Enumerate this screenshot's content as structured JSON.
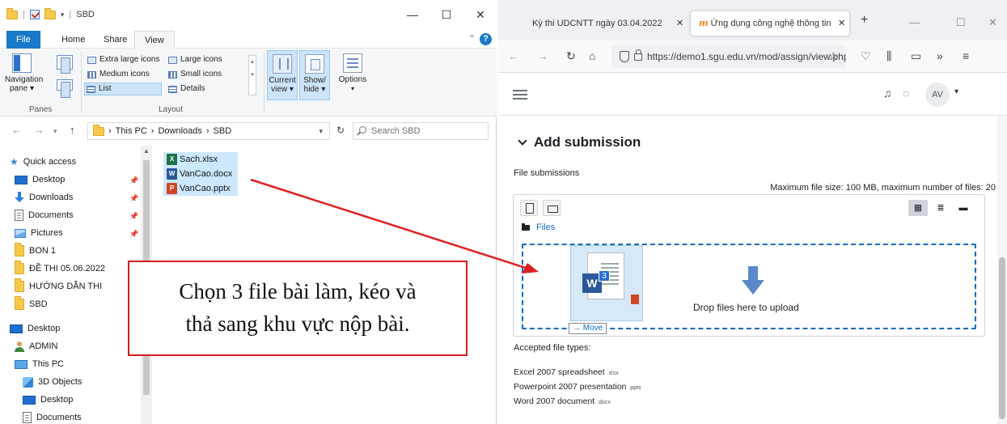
{
  "explorer": {
    "titlebar": {
      "title": "SBD",
      "minimize": "—",
      "maximize": "☐",
      "close": "✕"
    },
    "tabs": [
      "File",
      "Home",
      "Share",
      "View"
    ],
    "ribbon": {
      "panes": {
        "navigation_pane": "Navigation pane ▾",
        "group_label": "Panes"
      },
      "layout": {
        "items": [
          "Extra large icons",
          "Large icons",
          "Medium icons",
          "Small icons",
          "List",
          "Details"
        ],
        "selected": "List",
        "group_label": "Layout"
      },
      "current_view": "Current view ▾",
      "show_hide": "Show/ hide ▾",
      "options": "Options"
    },
    "address": {
      "crumbs": [
        "This PC",
        "Downloads",
        "SBD"
      ],
      "search_placeholder": "Search SBD"
    },
    "nav_pane": {
      "quick_access": "Quick access",
      "pinned": [
        "Desktop",
        "Downloads",
        "Documents",
        "Pictures"
      ],
      "folders": [
        "BON 1",
        "ĐỀ THI 05.06.2022",
        "HƯỚNG DẪN THI",
        "SBD"
      ],
      "desktop": "Desktop",
      "admin": "ADMIN",
      "this_pc": "This PC",
      "pc_items": [
        "3D Objects",
        "Desktop",
        "Documents"
      ]
    },
    "files": [
      {
        "name": "Sach.xlsx",
        "icon": "excel-icon",
        "glyph": "X"
      },
      {
        "name": "VanCao.docx",
        "icon": "word-icon",
        "glyph": "W"
      },
      {
        "name": "VanCao.pptx",
        "icon": "powerpoint-icon",
        "glyph": "P"
      }
    ]
  },
  "browser": {
    "tabs": [
      {
        "label": "Kỳ thi UDCNTT ngày 03.04.2022",
        "active": false
      },
      {
        "label": "Ứng dụng công nghệ thông tin",
        "active": true
      }
    ],
    "url": "https://demo1.sgu.edu.vn/mod/assign/view.php",
    "avatar": "AV",
    "section_title": "Add submission",
    "file_submissions_label": "File submissions",
    "max_info": "Maximum file size: 100 MB, maximum number of files: 20",
    "files_path": "Files",
    "drop_text": "Drop files here to upload",
    "drag_count": "3",
    "move_tooltip": "→ Move",
    "accepted_label": "Accepted file types:",
    "file_types": [
      {
        "name": "Excel 2007 spreadsheet",
        "ext": ".xlsx"
      },
      {
        "name": "Powerpoint 2007 presentation",
        "ext": ".pptx"
      },
      {
        "name": "Word 2007 document",
        "ext": ".docx"
      }
    ]
  },
  "callout": {
    "line1": "Chọn 3 file bài làm, kéo và",
    "line2": "thả sang khu vực nộp bài."
  },
  "colors": {
    "arrow": "#e02020",
    "callout_border": "#d41c1c",
    "accent": "#0f6cbf",
    "selection": "#cce8ff"
  }
}
